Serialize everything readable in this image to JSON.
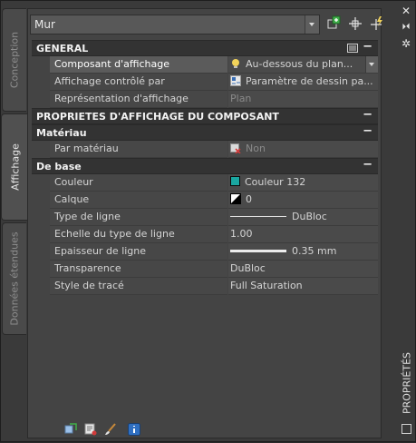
{
  "palette": {
    "accent_teal": "#1aa7a1",
    "bulb_yellow": "#f2d35a",
    "section_bg": "#333333",
    "panel_bg": "#444444"
  },
  "tabs": {
    "conception": "Conception",
    "affichage": "Affichage",
    "donnees": "Données étendues"
  },
  "header": {
    "object_type": "Mur",
    "tools": [
      "add-icon",
      "select-icon",
      "quickselect-icon"
    ]
  },
  "sections": {
    "general": {
      "title": "GENERAL",
      "rows": [
        {
          "label": "Composant d'affichage",
          "value": "Au-dessous du plan..."
        },
        {
          "label": "Affichage contrôlé par",
          "value": "Paramètre de dessin pa..."
        },
        {
          "label": "Représentation d'affichage",
          "value": "Plan"
        }
      ]
    },
    "props_title": "PROPRIETES D'AFFICHAGE DU COMPOSANT",
    "materiau": {
      "title": "Matériau",
      "rows": [
        {
          "label": "Par matériau",
          "value": "Non"
        }
      ]
    },
    "debase": {
      "title": "De base",
      "rows": [
        {
          "label": "Couleur",
          "value": "Couleur 132"
        },
        {
          "label": "Calque",
          "value": "0"
        },
        {
          "label": "Type de ligne",
          "value": "DuBloc"
        },
        {
          "label": "Echelle du type de ligne",
          "value": "1.00"
        },
        {
          "label": "Epaisseur de ligne",
          "value": "0.35 mm"
        },
        {
          "label": "Transparence",
          "value": "DuBloc"
        },
        {
          "label": "Style de tracé",
          "value": "Full Saturation"
        }
      ]
    }
  },
  "palette_title": "PROPRIÉTÉS"
}
